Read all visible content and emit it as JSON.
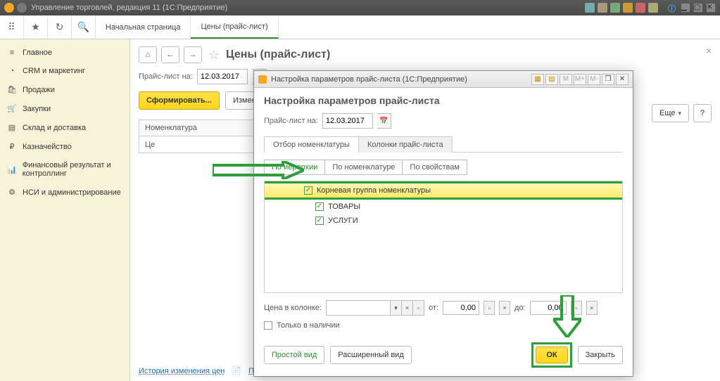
{
  "titlebar": {
    "app_title": "Управление торговлей, редакция 11  (1С:Предприятие)"
  },
  "maintabs": {
    "home": "Начальная страница",
    "prices": "Цены (прайс-лист)"
  },
  "sidebar": {
    "items": [
      {
        "icon": "≡",
        "label": "Главное"
      },
      {
        "icon": "◔",
        "label": "CRM и маркетинг"
      },
      {
        "icon": "🛍",
        "label": "Продажи"
      },
      {
        "icon": "🛒",
        "label": "Закупки"
      },
      {
        "icon": "▤",
        "label": "Склад и доставка"
      },
      {
        "icon": "₽",
        "label": "Казначейство"
      },
      {
        "icon": "📊",
        "label": "Финансовый результат и контроллинг"
      },
      {
        "icon": "⚙",
        "label": "НСИ и администрирование"
      }
    ]
  },
  "page": {
    "title": "Цены (прайс-лист)",
    "date_label": "Прайс-лист на:",
    "date_value": "12.03.2017",
    "form_btn": "Сформировать...",
    "change_btn": "Изменить цены",
    "more_btn": "Еще",
    "help": "?",
    "col_nomenclature": "Номенклатура",
    "col_price": "Це",
    "footer_history": "История изменения цен",
    "footer_pricelist": "Прайс-лист"
  },
  "dialog": {
    "window_title": "Настройка параметров прайс-листа  (1С:Предприятие)",
    "heading": "Настройка параметров прайс-листа",
    "date_label": "Прайс-лист на:",
    "date_value": "12.03.2017",
    "tabs": {
      "tab1": "Отбор номенклатуры",
      "tab2": "Колонки прайс-листа"
    },
    "subtabs": {
      "s1": "По иерархии",
      "s2": "По номенклатуре",
      "s3": "По свойствам"
    },
    "tree": {
      "root": "Корневая группа номенклатуры",
      "goods": "ТОВАРЫ",
      "services": "УСЛУГИ"
    },
    "filter": {
      "price_col_label": "Цена в колонке:",
      "from_label": "от:",
      "from_value": "0,00",
      "to_label": "до:",
      "to_value": "0,00",
      "stock_only": "Только в наличии"
    },
    "footer": {
      "simple": "Простой вид",
      "advanced": "Расширенный вид",
      "ok": "ОК",
      "close": "Закрыть"
    },
    "winbtns": {
      "m_minus": "M-",
      "m_plus": "M+",
      "m": "M"
    }
  }
}
